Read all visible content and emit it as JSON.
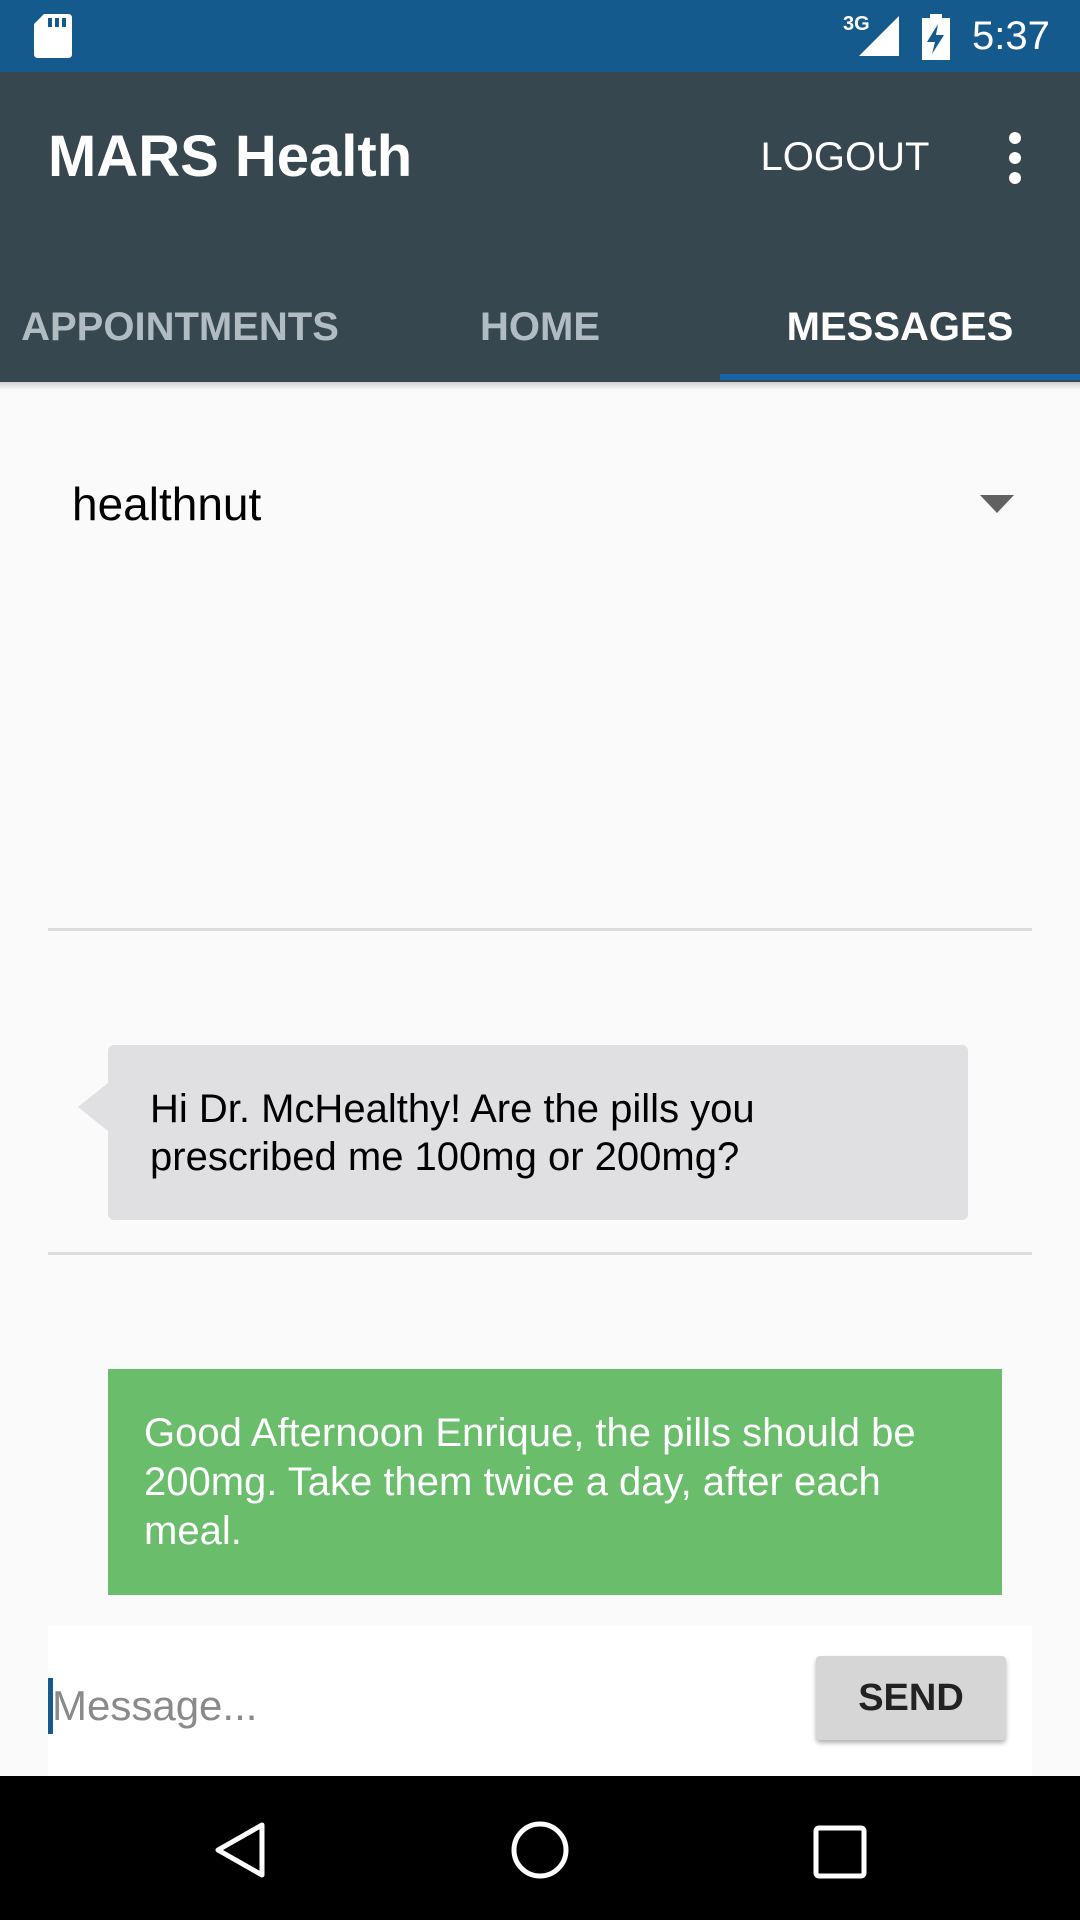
{
  "status_bar": {
    "time": "5:37",
    "network": "3G",
    "icons": [
      "sd-card-icon",
      "signal-icon",
      "battery-charging-icon"
    ]
  },
  "app_bar": {
    "title": "MARS Health",
    "logout_label": "LOGOUT",
    "overflow_icon": "more-vert-icon"
  },
  "tabs": [
    {
      "label": "APPOINTMENTS",
      "active": false
    },
    {
      "label": "HOME",
      "active": false
    },
    {
      "label": "MESSAGES",
      "active": true
    }
  ],
  "recipient": {
    "selected": "healthnut",
    "icon": "dropdown-arrow-icon"
  },
  "messages": [
    {
      "type": "received",
      "text": "Hi Dr. McHealthy! Are the pills you prescribed me 100mg or 200mg?"
    },
    {
      "type": "sent",
      "text": "Good Afternoon Enrique, the pills should be 200mg. Take them twice a day, after each meal."
    }
  ],
  "composer": {
    "value": "",
    "placeholder": "Message...",
    "send_label": "SEND"
  },
  "nav_bar": {
    "icons": [
      "back-icon",
      "home-icon",
      "recents-icon"
    ]
  },
  "colors": {
    "status_bar": "#155a8c",
    "app_bar": "#37474f",
    "tab_indicator": "#1565a8",
    "received_bubble": "#e0dfe1",
    "sent_bubble": "#69bd6b"
  }
}
